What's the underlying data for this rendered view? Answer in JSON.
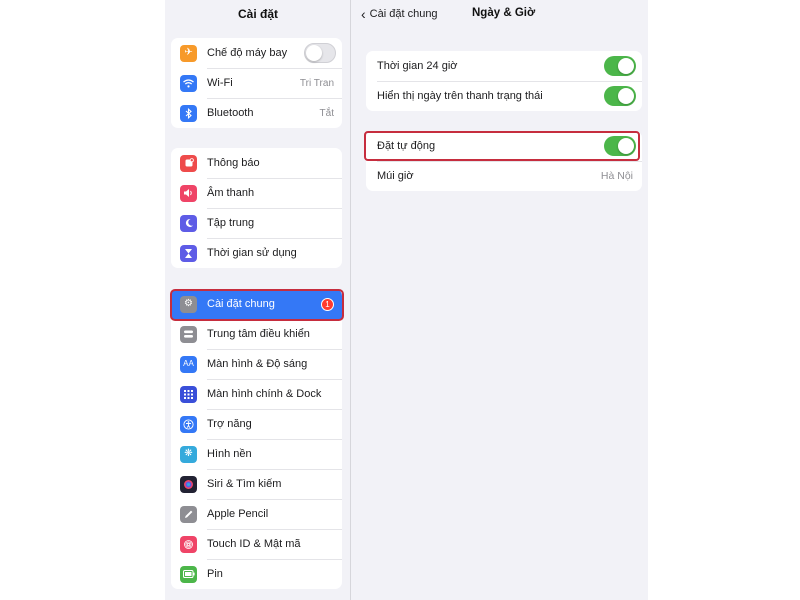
{
  "sidebar": {
    "title": "Cài đặt",
    "groups": [
      {
        "items": [
          {
            "label": "Chế độ máy bay",
            "icon": "airplane-icon",
            "color": "#f79a2a",
            "toggle": "off"
          },
          {
            "label": "Wi-Fi",
            "icon": "wifi-icon",
            "color": "#3478f6",
            "value": "Tri Tran"
          },
          {
            "label": "Bluetooth",
            "icon": "bluetooth-icon",
            "color": "#3478f6",
            "value": "Tắt"
          }
        ]
      },
      {
        "items": [
          {
            "label": "Thông báo",
            "icon": "bell-icon",
            "color": "#ee4b4b"
          },
          {
            "label": "Âm thanh",
            "icon": "speaker-icon",
            "color": "#ef4467"
          },
          {
            "label": "Tập trung",
            "icon": "moon-icon",
            "color": "#5e5ce6"
          },
          {
            "label": "Thời gian sử dụng",
            "icon": "hourglass-icon",
            "color": "#5e5ce6"
          }
        ]
      },
      {
        "items": [
          {
            "label": "Cài đặt chung",
            "icon": "gear-icon",
            "color": "#8e8e93",
            "selected": true,
            "badge": "1"
          },
          {
            "label": "Trung tâm điều khiển",
            "icon": "switches-icon",
            "color": "#8e8e93"
          },
          {
            "label": "Màn hình & Độ sáng",
            "icon": "text-size-icon",
            "color": "#3478f6"
          },
          {
            "label": "Màn hình chính & Dock",
            "icon": "app-grid-icon",
            "color": "#3a4fd9"
          },
          {
            "label": "Trợ năng",
            "icon": "accessibility-icon",
            "color": "#3478f6"
          },
          {
            "label": "Hình nền",
            "icon": "flower-icon",
            "color": "#35aadc"
          },
          {
            "label": "Siri & Tìm kiếm",
            "icon": "siri-icon",
            "color": "#222233"
          },
          {
            "label": "Apple Pencil",
            "icon": "pencil-icon",
            "color": "#8e8e93"
          },
          {
            "label": "Touch ID & Mật mã",
            "icon": "fingerprint-icon",
            "color": "#ef4467"
          },
          {
            "label": "Pin",
            "icon": "battery-icon",
            "color": "#4cb64a"
          }
        ]
      }
    ]
  },
  "detail": {
    "back_label": "Cài đặt chung",
    "title": "Ngày & Giờ",
    "group1": [
      {
        "label": "Thời gian 24 giờ",
        "toggle": "on"
      },
      {
        "label": "Hiển thị ngày trên thanh trạng thái",
        "toggle": "on"
      }
    ],
    "group2": [
      {
        "label": "Đặt tự động",
        "toggle": "on"
      },
      {
        "label": "Múi giờ",
        "value": "Hà Nội"
      }
    ]
  },
  "colors": {
    "accent": "#3478f6",
    "toggle_on": "#4cb64a",
    "highlight": "#c62d3e"
  }
}
